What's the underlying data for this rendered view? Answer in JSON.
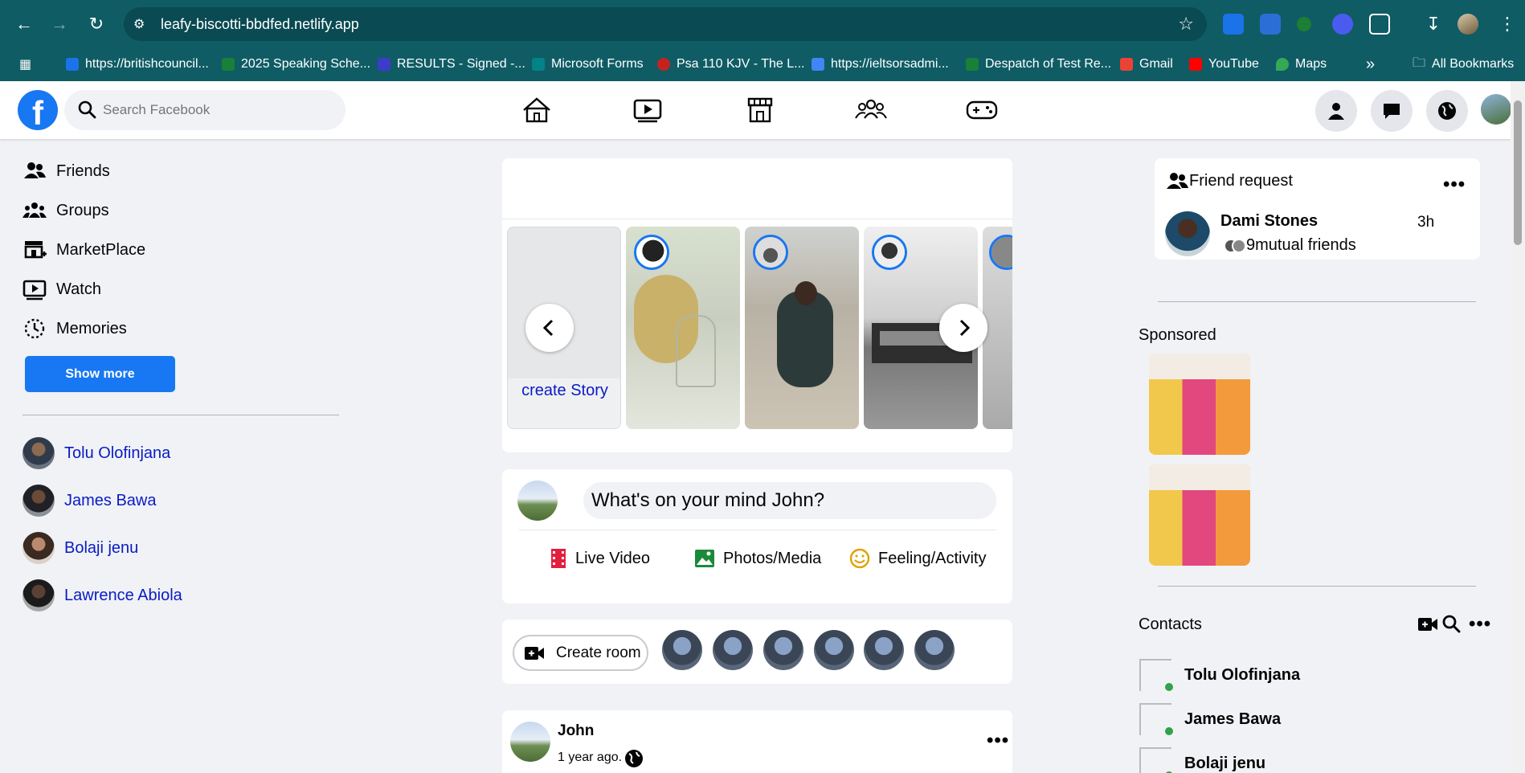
{
  "browser": {
    "url": "leafy-biscotti-bbdfed.netlify.app",
    "bookmarks": [
      {
        "label": "https://britishcouncil...",
        "color": "#1a73e8"
      },
      {
        "label": "2025 Speaking Sche...",
        "color": "#188038"
      },
      {
        "label": "RESULTS - Signed -...",
        "color": "#3c3cc8"
      },
      {
        "label": "Microsoft Forms",
        "color": "#038387"
      },
      {
        "label": "Psa 110 KJV - The L...",
        "color": "#c5221f"
      },
      {
        "label": "https://ieltsorsadmi...",
        "color": "#4285f4"
      },
      {
        "label": "Despatch of Test Re...",
        "color": "#188038"
      },
      {
        "label": "Gmail",
        "color": "#ea4335"
      },
      {
        "label": "YouTube",
        "color": "#ff0000"
      },
      {
        "label": "Maps",
        "color": "#34a853"
      }
    ],
    "all_bookmarks": "All Bookmarks",
    "more_bookmarks": "»"
  },
  "header": {
    "logo": "f",
    "search_placeholder": "Search Facebook"
  },
  "sidebar": {
    "items": [
      {
        "label": "Friends",
        "icon": "friends-icon"
      },
      {
        "label": "Groups",
        "icon": "groups-icon"
      },
      {
        "label": "MarketPlace",
        "icon": "marketplace-icon"
      },
      {
        "label": "Watch",
        "icon": "watch-icon"
      },
      {
        "label": "Memories",
        "icon": "memories-icon"
      }
    ],
    "show_more": "Show more",
    "friends": [
      "Tolu Olofinjana",
      "James Bawa",
      "Bolaji jenu",
      "Lawrence Abiola"
    ]
  },
  "stories": {
    "create_label": "create Story"
  },
  "composer": {
    "placeholder": "What's on your mind John?",
    "live_video": "Live Video",
    "photos_media": "Photos/Media",
    "feeling_activity": "Feeling/Activity"
  },
  "rooms": {
    "create_room": "Create room"
  },
  "post": {
    "author": "John",
    "time": "1 year ago."
  },
  "right": {
    "friend_request_title": "Friend request",
    "request": {
      "name": "Dami Stones",
      "time": "3h",
      "mutual": "9mutual friends"
    },
    "sponsored_title": "Sponsored",
    "contacts_title": "Contacts",
    "contacts": [
      "Tolu Olofinjana",
      "James Bawa",
      "Bolaji jenu"
    ]
  },
  "colors": {
    "brand": "#1877f2",
    "chrome": "#0f5c65",
    "link": "#0a1bc4",
    "online": "#31a24c"
  }
}
